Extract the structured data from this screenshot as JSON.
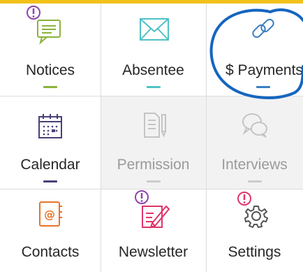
{
  "colors": {
    "top_bar": "#f2c21a",
    "underline_notices": "#8ab33c",
    "underline_absentee": "#4fc1c6",
    "underline_payments": "#3c7ec0",
    "underline_calendar": "#4a3f79",
    "underline_permission": "#cccccc",
    "underline_interviews": "#cccccc",
    "badge": "#8e44ad",
    "annotation_pen": "#1565c0"
  },
  "tiles": [
    {
      "label": "Notices",
      "icon": "notice-speech-icon",
      "badge": true,
      "disabled": false
    },
    {
      "label": "Absentee",
      "icon": "envelope-icon",
      "badge": false,
      "disabled": false
    },
    {
      "label": "$ Payments",
      "icon": "link-icon",
      "badge": false,
      "disabled": false
    },
    {
      "label": "Calendar",
      "icon": "calendar-icon",
      "badge": false,
      "disabled": false
    },
    {
      "label": "Permission",
      "icon": "permission-form-icon",
      "badge": false,
      "disabled": true
    },
    {
      "label": "Interviews",
      "icon": "chat-bubbles-icon",
      "badge": false,
      "disabled": true
    },
    {
      "label": "Contacts",
      "icon": "address-book-icon",
      "badge": false,
      "disabled": false
    },
    {
      "label": "Newsletter",
      "icon": "newsletter-pen-icon",
      "badge": true,
      "disabled": false
    },
    {
      "label": "Settings",
      "icon": "gear-icon",
      "badge": true,
      "disabled": false
    }
  ]
}
